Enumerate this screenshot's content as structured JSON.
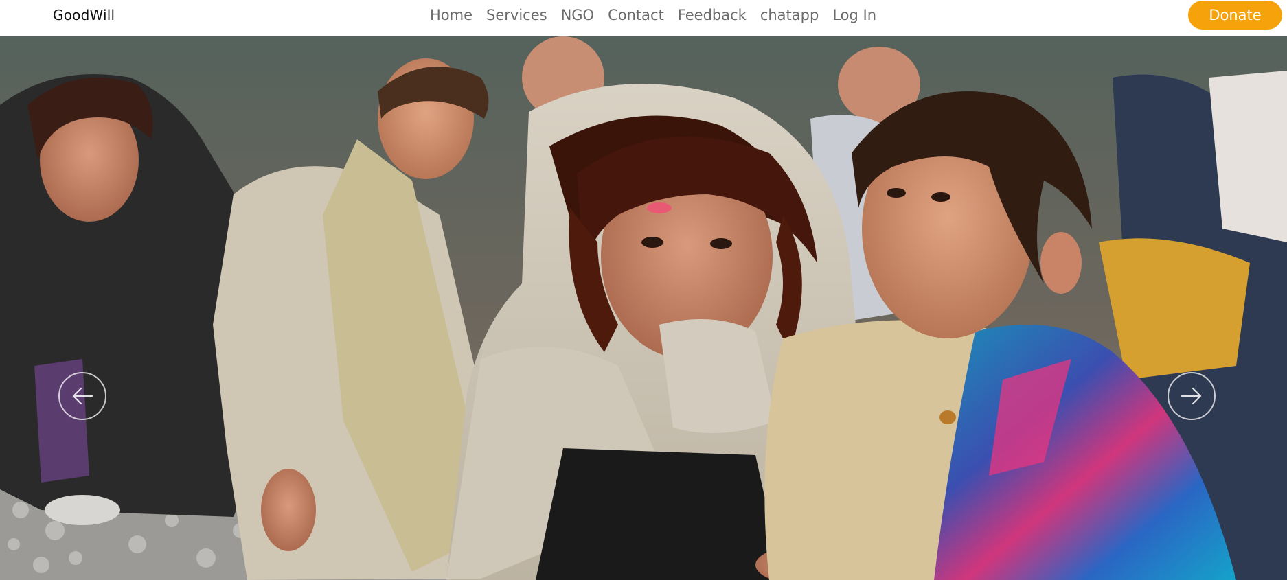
{
  "brand": {
    "name": "GoodWill"
  },
  "nav": {
    "items": [
      {
        "label": "Home"
      },
      {
        "label": "Services"
      },
      {
        "label": "NGO"
      },
      {
        "label": "Contact"
      },
      {
        "label": "Feedback"
      },
      {
        "label": "chatapp"
      },
      {
        "label": "Log In"
      }
    ]
  },
  "donate": {
    "label": "Donate"
  },
  "colors": {
    "accent": "#f6a20b",
    "nav_text": "#6b6b6b",
    "brand_text": "#111111"
  },
  "hero": {
    "prev_icon": "arrow-left-icon",
    "next_icon": "arrow-right-icon"
  }
}
